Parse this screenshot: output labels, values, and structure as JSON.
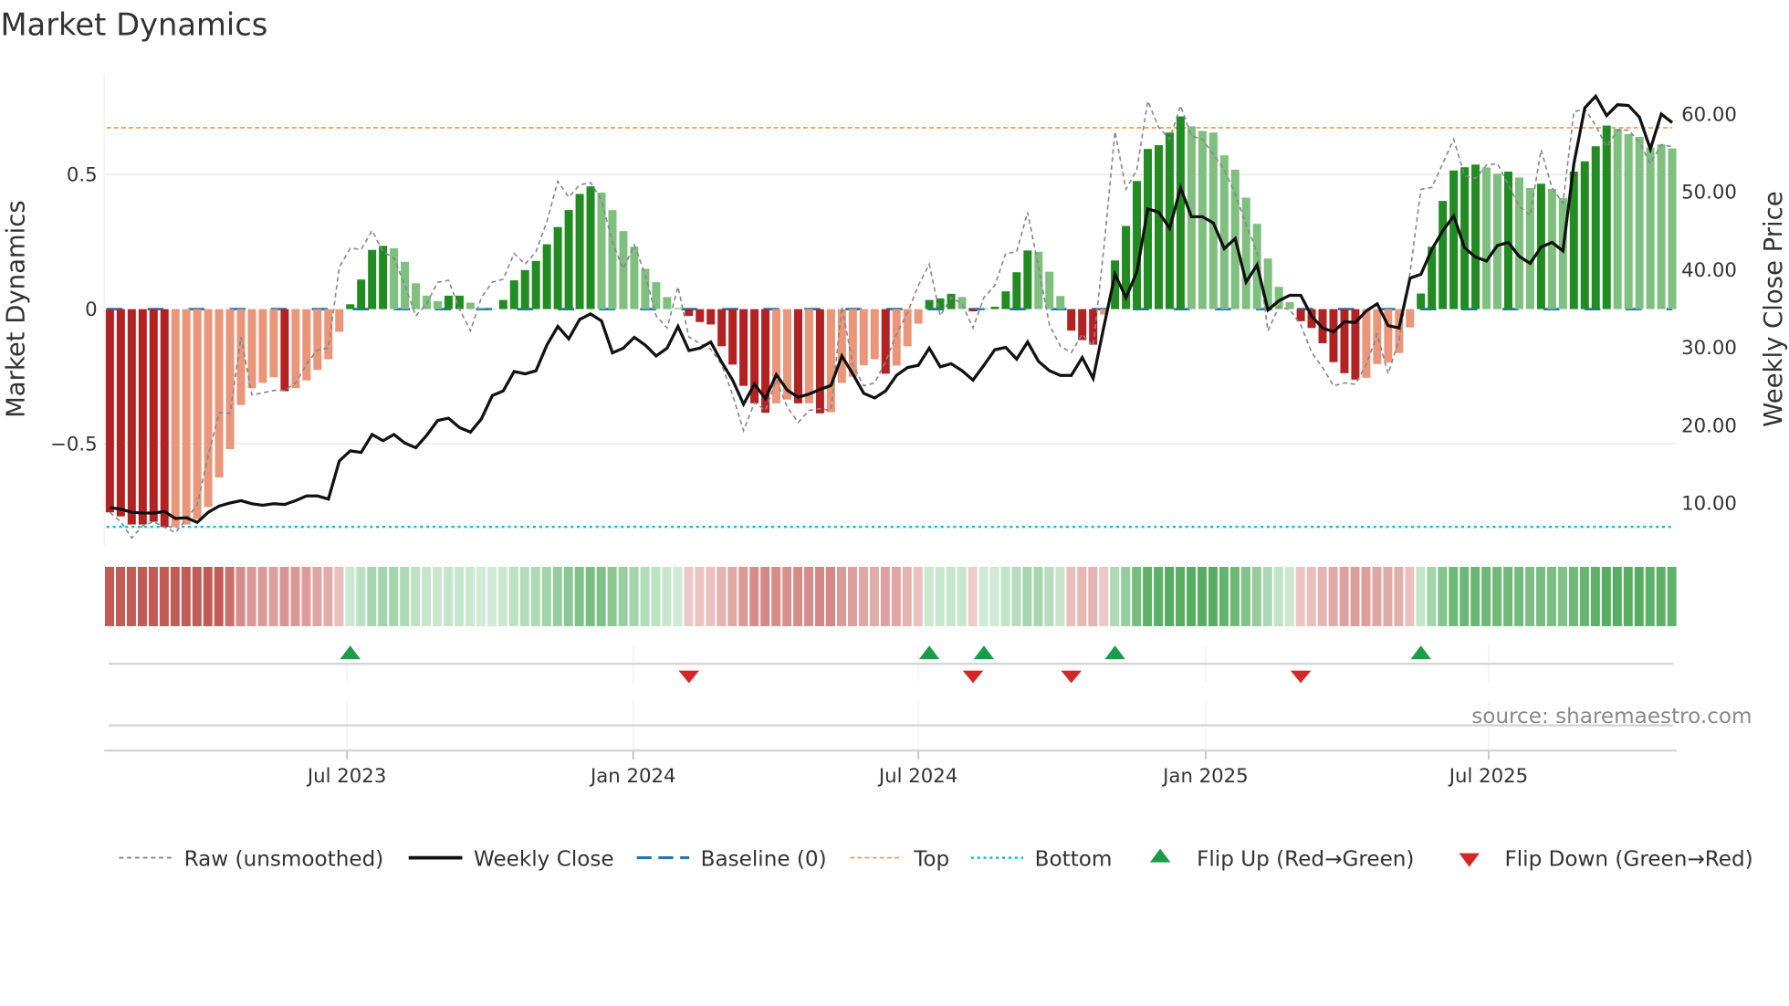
{
  "title": "Market Dynamics",
  "source": "source: sharemaestro.com",
  "colors": {
    "dark_red": "#b22222",
    "light_red": "#e9967a",
    "dark_green": "#228b22",
    "light_green": "#7fbf7f",
    "raw": "#888888",
    "close": "#111111",
    "baseline": "#1f77b4",
    "top": "#f4a460",
    "bottom": "#17becf",
    "flip_up": "#1a9c4a",
    "flip_down": "#d62728",
    "strip_red": "#c25a55",
    "strip_green": "#57ad62"
  },
  "chart_data": {
    "type": "bar",
    "title": "Market Dynamics",
    "ylabel": "Market Dynamics",
    "y2label": "Weekly Close Price",
    "ylim": [
      -0.877,
      0.873
    ],
    "y2lim": [
      4.57,
      65.13
    ],
    "yticks": [
      {
        "value": 0.5,
        "label": "0.5"
      },
      {
        "value": 0,
        "label": "0"
      },
      {
        "value": -0.5,
        "label": "−0.5"
      }
    ],
    "y2ticks": [
      {
        "value": 60,
        "label": "60.00"
      },
      {
        "value": 50,
        "label": "50.00"
      },
      {
        "value": 40,
        "label": "40.00"
      },
      {
        "value": 30,
        "label": "30.00"
      },
      {
        "value": 20,
        "label": "20.00"
      },
      {
        "value": 10,
        "label": "10.00"
      }
    ],
    "xticks": [
      {
        "index": 21.7,
        "label": "Jul 2023"
      },
      {
        "index": 47.9,
        "label": "Jan 2024"
      },
      {
        "index": 74.0,
        "label": "Jul 2024"
      },
      {
        "index": 100.3,
        "label": "Jan 2025"
      },
      {
        "index": 126.2,
        "label": "Jul 2025"
      }
    ],
    "top_level": 0.674,
    "bottom_level": -0.809,
    "baseline": 0,
    "grid": true,
    "legend_placement": "bottom",
    "values": [
      -0.755,
      -0.77,
      -0.8,
      -0.8,
      -0.79,
      -0.81,
      -0.81,
      -0.8,
      -0.78,
      -0.735,
      -0.625,
      -0.52,
      -0.356,
      -0.294,
      -0.274,
      -0.253,
      -0.305,
      -0.293,
      -0.265,
      -0.226,
      -0.186,
      -0.084,
      0.018,
      0.11,
      0.22,
      0.235,
      0.226,
      0.176,
      0.096,
      0.05,
      0.03,
      0.05,
      0.05,
      0.024,
      0.005,
      0.002,
      0.034,
      0.107,
      0.145,
      0.179,
      0.241,
      0.305,
      0.368,
      0.428,
      0.456,
      0.433,
      0.368,
      0.29,
      0.232,
      0.15,
      0.1,
      0.045,
      0.004,
      -0.025,
      -0.048,
      -0.057,
      -0.138,
      -0.206,
      -0.285,
      -0.35,
      -0.385,
      -0.35,
      -0.336,
      -0.35,
      -0.35,
      -0.387,
      -0.383,
      -0.274,
      -0.251,
      -0.208,
      -0.186,
      -0.24,
      -0.21,
      -0.138,
      -0.054,
      0.034,
      0.04,
      0.057,
      0.045,
      -0.008,
      0.003,
      0.009,
      0.066,
      0.137,
      0.218,
      0.213,
      0.139,
      0.049,
      -0.08,
      -0.115,
      -0.132,
      -0.02,
      0.181,
      0.309,
      0.476,
      0.595,
      0.609,
      0.656,
      0.716,
      0.679,
      0.662,
      0.656,
      0.571,
      0.518,
      0.414,
      0.317,
      0.188,
      0.083,
      0.026,
      -0.045,
      -0.07,
      -0.127,
      -0.197,
      -0.238,
      -0.262,
      -0.255,
      -0.204,
      -0.198,
      -0.163,
      -0.068,
      0.058,
      0.232,
      0.402,
      0.515,
      0.527,
      0.537,
      0.526,
      0.503,
      0.511,
      0.489,
      0.45,
      0.466,
      0.447,
      0.413,
      0.511,
      0.549,
      0.605,
      0.682,
      0.67,
      0.65,
      0.64,
      0.6,
      0.612,
      0.597
    ],
    "shade": "DDDDDDLLLLLLLLLLDLLLLLDDDDLLLLLDDLLLDDDDDDDDDLLLLLLLLDDDDDDDDLLDLDLLLLLDLLLDDDLDLDDDDLLLDDDLDDDDDDDLLLLLLLLLLDDDDDDLLLLLDDDDDDLLDLLDLLDDDDLLLLLL",
    "raw": [
      -0.755,
      -0.79,
      -0.85,
      -0.805,
      -0.79,
      -0.81,
      -0.83,
      -0.78,
      -0.726,
      -0.545,
      -0.385,
      -0.387,
      -0.104,
      -0.319,
      -0.311,
      -0.302,
      -0.302,
      -0.274,
      -0.204,
      -0.152,
      -0.144,
      0.156,
      0.226,
      0.222,
      0.292,
      0.213,
      0.19,
      0.088,
      -0.025,
      0.02,
      0.1,
      0.107,
      0,
      -0.081,
      0.043,
      0.1,
      0.111,
      0.207,
      0.167,
      0.213,
      0.326,
      0.475,
      0.416,
      0.462,
      0.47,
      0.405,
      0.247,
      0.15,
      0.238,
      0.128,
      -0.025,
      -0.07,
      0.083,
      -0.104,
      -0.127,
      -0.149,
      -0.206,
      -0.319,
      -0.452,
      -0.347,
      -0.376,
      -0.262,
      -0.364,
      -0.421,
      -0.376,
      -0.37,
      -0.376,
      0.009,
      -0.206,
      -0.285,
      -0.274,
      -0.195,
      -0.093,
      -0.014,
      0.088,
      0.167,
      -0.025,
      0.043,
      0.02,
      -0.07,
      0.043,
      0.088,
      0.207,
      0.213,
      0.36,
      0.156,
      -0.059,
      -0.138,
      -0.161,
      -0.093,
      -0.138,
      0.235,
      0.66,
      0.445,
      0.518,
      0.773,
      0.676,
      0.631,
      0.756,
      0.643,
      0.631,
      0.575,
      0.518,
      0.428,
      0.314,
      0.213,
      -0.081,
      0.009,
      -0.002,
      -0.059,
      -0.161,
      -0.217,
      -0.285,
      -0.274,
      -0.279,
      -0.206,
      -0.093,
      -0.24,
      -0.115,
      0.133,
      0.445,
      0.452,
      0.541,
      0.631,
      0.495,
      0.486,
      0.535,
      0.541,
      0.462,
      0.382,
      0.348,
      0.592,
      0.45,
      0.394,
      0.733,
      0.744,
      0.682,
      0.603,
      0.665,
      0.665,
      0.62,
      0.541,
      0.611,
      0.603
    ],
    "close": [
      9.4,
      9.2,
      8.8,
      8.7,
      8.7,
      8.9,
      8.0,
      8.1,
      7.5,
      8.8,
      9.6,
      10.0,
      10.3,
      9.9,
      9.7,
      9.9,
      9.8,
      10.3,
      10.9,
      10.9,
      10.5,
      15.4,
      16.7,
      16.5,
      18.8,
      18.0,
      18.8,
      17.7,
      17.1,
      18.7,
      20.6,
      20.9,
      19.7,
      19.1,
      20.8,
      23.8,
      24.4,
      26.9,
      26.6,
      27.0,
      30.3,
      32.7,
      31.1,
      33.6,
      34.3,
      33.4,
      29.3,
      29.9,
      31.3,
      30.3,
      28.9,
      29.9,
      32.7,
      29.6,
      29.9,
      30.7,
      28.1,
      25.8,
      22.7,
      25.3,
      23.4,
      26.5,
      24.5,
      23.6,
      24.0,
      24.6,
      25.1,
      28.9,
      26.6,
      24.1,
      23.5,
      24.4,
      26.4,
      27.4,
      27.7,
      29.9,
      27.5,
      27.9,
      27.0,
      25.8,
      27.7,
      29.7,
      30.0,
      28.5,
      30.7,
      28.2,
      27.0,
      26.4,
      26.4,
      28.7,
      26.0,
      32.8,
      39.4,
      36.4,
      39.7,
      47.8,
      47.4,
      45.3,
      50.5,
      46.8,
      46.8,
      46.0,
      42.7,
      44.0,
      38.4,
      40.6,
      34.8,
      36.0,
      36.7,
      36.7,
      34.0,
      32.5,
      32.0,
      33.3,
      33.2,
      34.7,
      35.6,
      32.8,
      32.5,
      38.9,
      39.4,
      42.6,
      45.0,
      46.9,
      42.8,
      41.6,
      41.1,
      43.1,
      43.5,
      41.7,
      40.8,
      42.9,
      43.5,
      42.4,
      53.6,
      60.8,
      62.3,
      59.8,
      61.2,
      61.1,
      59.6,
      55.5,
      60.0,
      58.9
    ],
    "flip_up": [
      22,
      75,
      80,
      92,
      120
    ],
    "flip_down": [
      53,
      79,
      88,
      109
    ],
    "legend": [
      {
        "key": "raw",
        "label": "Raw (unsmoothed)"
      },
      {
        "key": "close",
        "label": "Weekly Close"
      },
      {
        "key": "baseline",
        "label": "Baseline (0)"
      },
      {
        "key": "top",
        "label": "Top"
      },
      {
        "key": "bottom",
        "label": "Bottom"
      },
      {
        "key": "flip_up",
        "label": "Flip Up (Red→Green)"
      },
      {
        "key": "flip_down",
        "label": "Flip Down (Green→Red)"
      }
    ]
  }
}
